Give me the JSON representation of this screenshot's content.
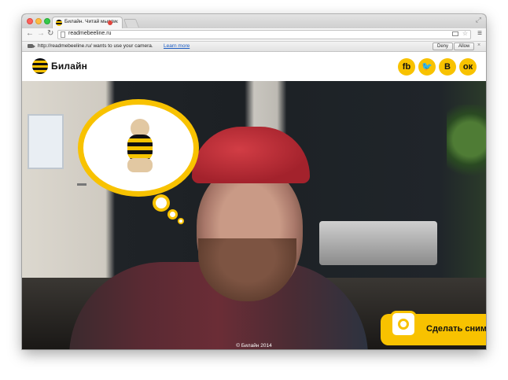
{
  "browser": {
    "tab_title": "Билайн. Читай мысли.",
    "tab_close": "×",
    "url": "readmebeeline.ru",
    "menu_glyph": "≡",
    "fullscreen_glyph": "⤢"
  },
  "infobar": {
    "message": "http://readmebeeline.ru/ wants to use your camera.",
    "learn_more": "Learn more",
    "deny_label": "Deny",
    "allow_label": "Allow",
    "close": "×"
  },
  "site": {
    "logo_text": "Билайн",
    "social": [
      {
        "label": "fb"
      },
      {
        "label": "🐦"
      },
      {
        "label": "В"
      },
      {
        "label": "ок"
      }
    ],
    "snapshot_label": "Сделать сним",
    "copyright": "© Билайн 2014"
  },
  "colors": {
    "brand_yellow": "#f8c200",
    "brand_black": "#111111"
  }
}
